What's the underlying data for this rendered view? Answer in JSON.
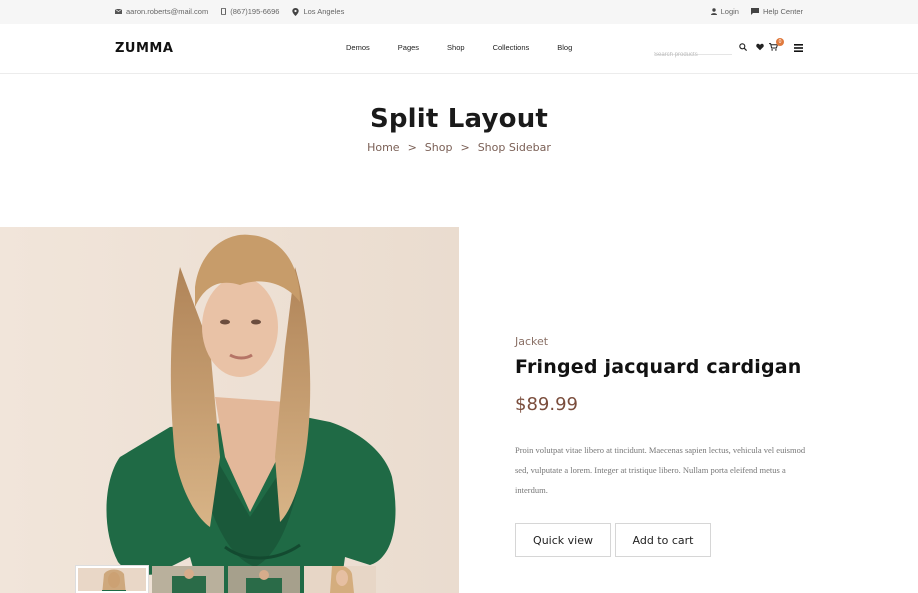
{
  "topbar": {
    "email": "aaron.roberts@mail.com",
    "phone": "(867)195-6696",
    "location": "Los Angeles",
    "login": "Login",
    "help": "Help Center"
  },
  "header": {
    "logo": "ZUMMA",
    "nav": [
      "Demos",
      "Pages",
      "Shop",
      "Collections",
      "Blog"
    ],
    "search_placeholder": "Search products",
    "cart_count": "0"
  },
  "page": {
    "title": "Split Layout",
    "breadcrumb": [
      "Home",
      "Shop",
      "Shop Sidebar"
    ],
    "breadcrumb_sep": ">"
  },
  "product": {
    "category": "Jacket",
    "title": "Fringed jacquard cardigan",
    "price": "$89.99",
    "description": "Proin volutpat vitae libero at tincidunt. Maecenas sapien lectus, vehicula vel euismod sed, vulputate a lorem. Integer at tristique libero. Nullam porta eleifend metus a interdum.",
    "quick_view": "Quick view",
    "add_to_cart": "Add to cart",
    "thumbnail_count": 4
  },
  "colors": {
    "accent": "#7a4d3c",
    "badge": "#e07a3e",
    "image_bg": "#efe2d6"
  },
  "icons": [
    "envelope-icon",
    "phone-icon",
    "location-icon",
    "user-icon",
    "chat-icon",
    "search-icon",
    "heart-icon",
    "cart-icon",
    "menu-icon"
  ]
}
